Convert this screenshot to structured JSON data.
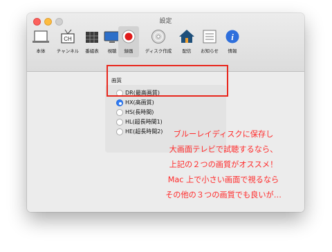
{
  "window": {
    "title": "設定"
  },
  "toolbar": [
    {
      "label": "本体",
      "icon": "device-icon"
    },
    {
      "label": "チャンネル",
      "icon": "channel-antenna-icon"
    },
    {
      "label": "番組表",
      "icon": "program-guide-icon"
    },
    {
      "label": "視聴",
      "icon": "tv-monitor-icon"
    },
    {
      "label": "録画",
      "icon": "record-icon",
      "selected": true
    },
    {
      "label": "ディスク作成",
      "icon": "disc-icon"
    },
    {
      "label": "配信",
      "icon": "house-icon"
    },
    {
      "label": "お知らせ",
      "icon": "notice-list-icon"
    },
    {
      "label": "情報",
      "icon": "info-icon"
    }
  ],
  "recording": {
    "quality_label": "画質",
    "options": [
      {
        "label": "DR(最高画質)",
        "selected": false
      },
      {
        "label": "HX(高画質)",
        "selected": true
      },
      {
        "label": "HS(長時間)",
        "selected": false
      },
      {
        "label": "HL(超長時間1)",
        "selected": false
      },
      {
        "label": "HE(超長時間2)",
        "selected": false
      }
    ]
  },
  "annotation": {
    "lines": [
      "ブルーレイディスクに保存し",
      "大画面テレビで試聴するなら、",
      "上記の２つの画質がオススメ！",
      "Mac 上で小さい画面で視るなら",
      "その他の３つの画質でも良いが…"
    ]
  },
  "colors": {
    "accent": "#2f7cf6",
    "highlight_border": "#e8261c",
    "annotation_text": "#ff2a2a"
  }
}
